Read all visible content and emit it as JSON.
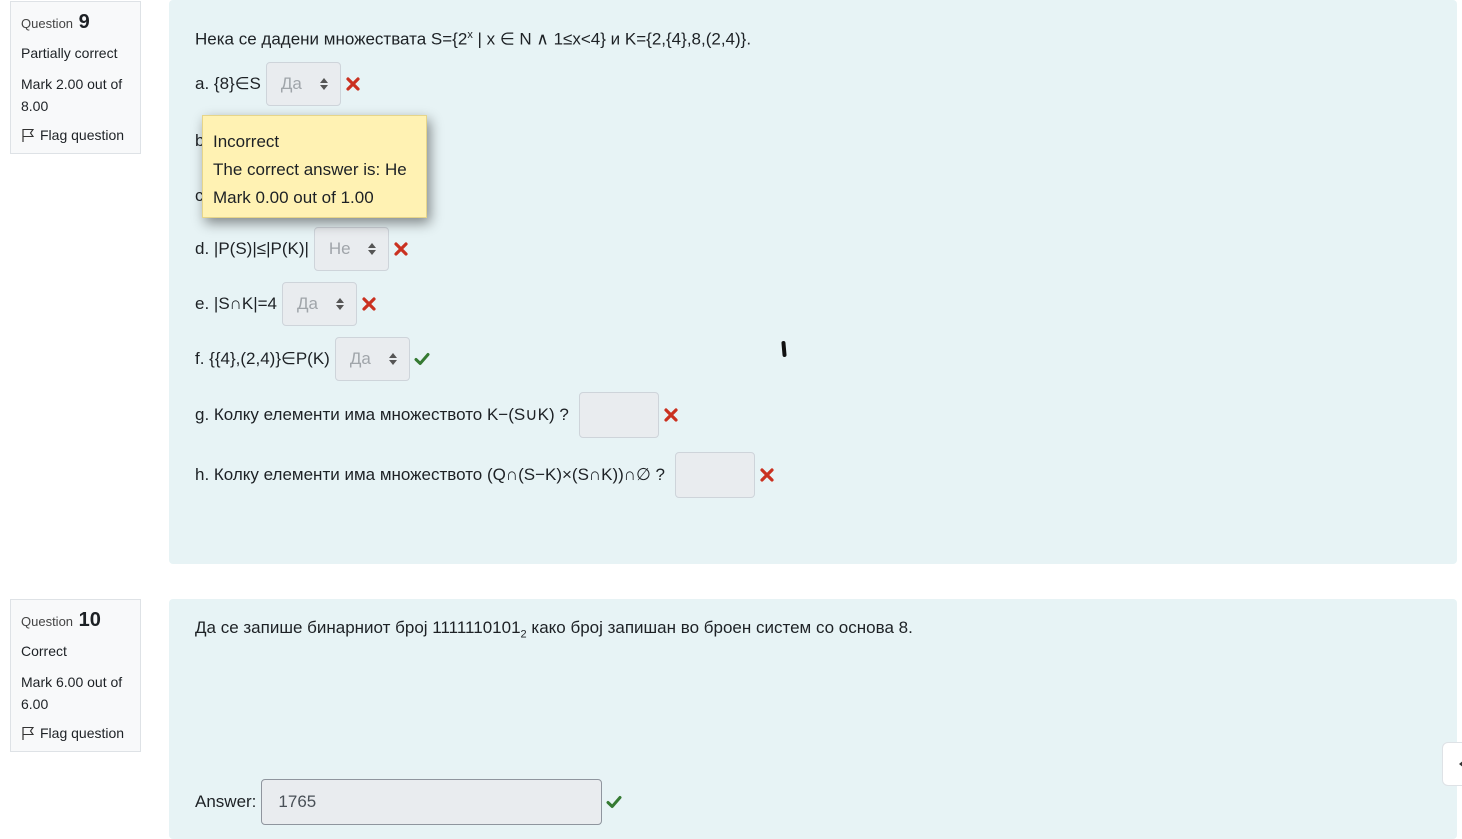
{
  "q9": {
    "qno_label": "Question",
    "qno": "9",
    "state": "Partially correct",
    "grade_line1": "Mark 2.00 out of",
    "grade_line2": "8.00",
    "flag": "Flag question",
    "text_prefix": "Нека се дадени множествата S={2",
    "text_sup": "x",
    "text_suffix": " | x ∈ N ∧ 1≤x<4} и K={2,{4},8,(2,4)}.",
    "items": [
      {
        "label": "a. {8}∈S",
        "value": "Да",
        "result": "incorrect"
      },
      {
        "label": "b",
        "value": "",
        "result": ""
      },
      {
        "label": "c",
        "value": "",
        "result": ""
      },
      {
        "label": "d. |P(S)|≤|P(K)|",
        "value": "Не",
        "result": "incorrect"
      },
      {
        "label": "e. |S∩K|=4",
        "value": "Да",
        "result": "incorrect"
      },
      {
        "label": "f. {{4},(2,4)}∈P(K)",
        "value": "Да",
        "result": "correct"
      },
      {
        "label": "g. Колку елементи има множеството K−(S∪K) ?",
        "value": "",
        "result": "incorrect"
      },
      {
        "label": "h. Колку елементи има множеството (Q∩(S−K)×(S∩K))∩∅ ?",
        "value": "",
        "result": "incorrect"
      }
    ],
    "tooltip": {
      "line1": "Incorrect",
      "line2": "The correct answer is: Не",
      "line3": "Mark 0.00 out of 1.00"
    }
  },
  "q10": {
    "qno_label": "Question",
    "qno": "10",
    "state": "Correct",
    "grade_line1": "Mark 6.00 out of",
    "grade_line2": "6.00",
    "flag": "Flag question",
    "text_prefix": "Да се запише бинарниот број 1111110101",
    "text_sub": "2",
    "text_suffix": " како број запишан во броен систем со основа 8.",
    "answer_label": "Answer:",
    "answer_value": "1765"
  },
  "colors": {
    "incorrect": "#ca3120",
    "correct": "#357a32",
    "content_bg": "#e7f3f5",
    "tooltip_bg": "#fff2b3"
  }
}
